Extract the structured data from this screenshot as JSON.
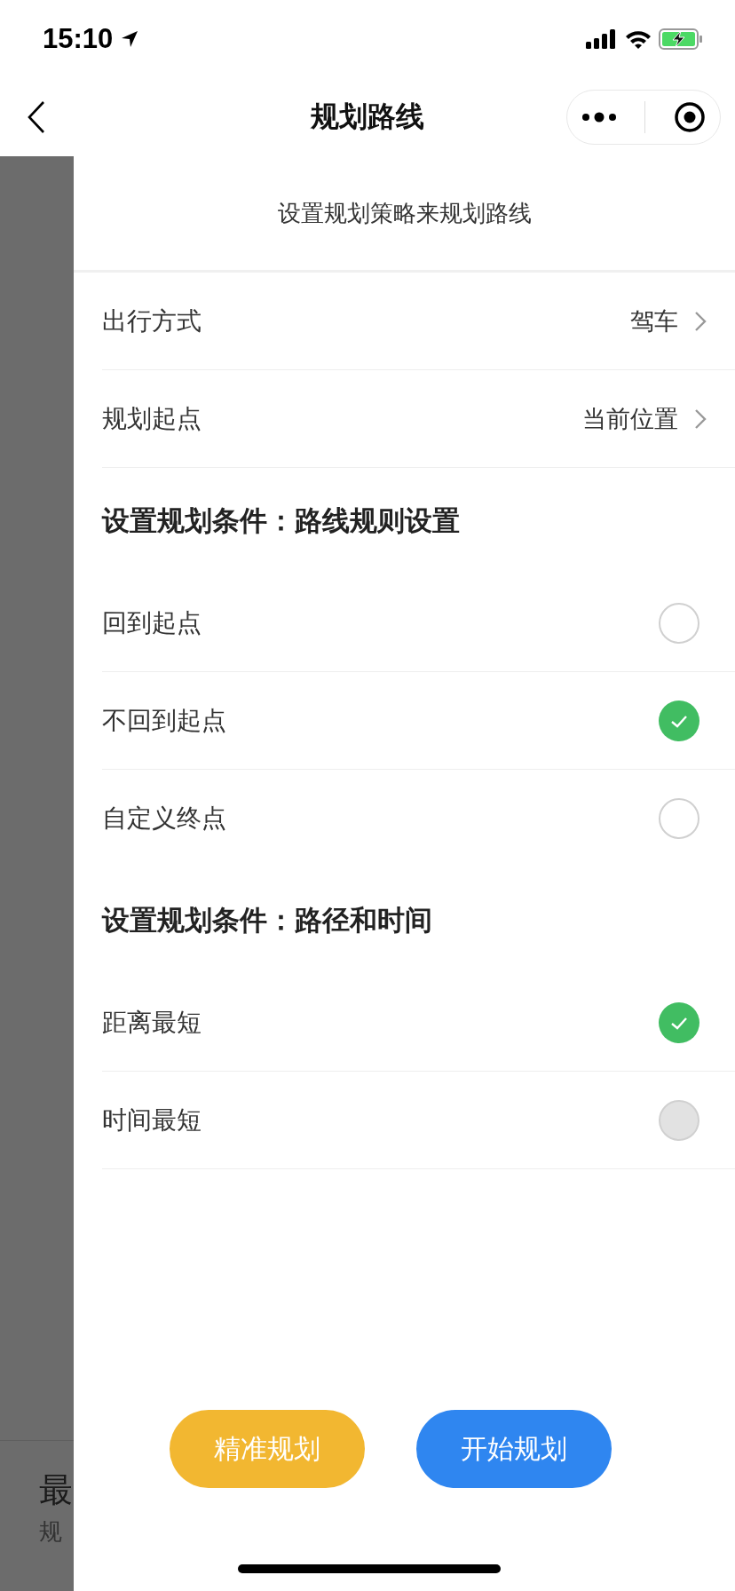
{
  "status_bar": {
    "time": "15:10"
  },
  "nav": {
    "title": "规划路线"
  },
  "backdrop": {
    "title": "最",
    "subtitle": "规"
  },
  "panel": {
    "subtitle": "设置规划策略来规划路线",
    "settings": [
      {
        "label": "出行方式",
        "value": "驾车"
      },
      {
        "label": "规划起点",
        "value": "当前位置"
      }
    ],
    "sections": [
      {
        "heading": "设置规划条件：路线规则设置",
        "options": [
          {
            "label": "回到起点",
            "selected": false,
            "disabled": false
          },
          {
            "label": "不回到起点",
            "selected": true,
            "disabled": false
          },
          {
            "label": "自定义终点",
            "selected": false,
            "disabled": false
          }
        ]
      },
      {
        "heading": "设置规划条件：路径和时间",
        "options": [
          {
            "label": "距离最短",
            "selected": true,
            "disabled": false
          },
          {
            "label": "时间最短",
            "selected": false,
            "disabled": true
          }
        ]
      }
    ]
  },
  "buttons": [
    {
      "label": "精准规划",
      "kind": "secondary"
    },
    {
      "label": "开始规划",
      "kind": "primary"
    }
  ]
}
